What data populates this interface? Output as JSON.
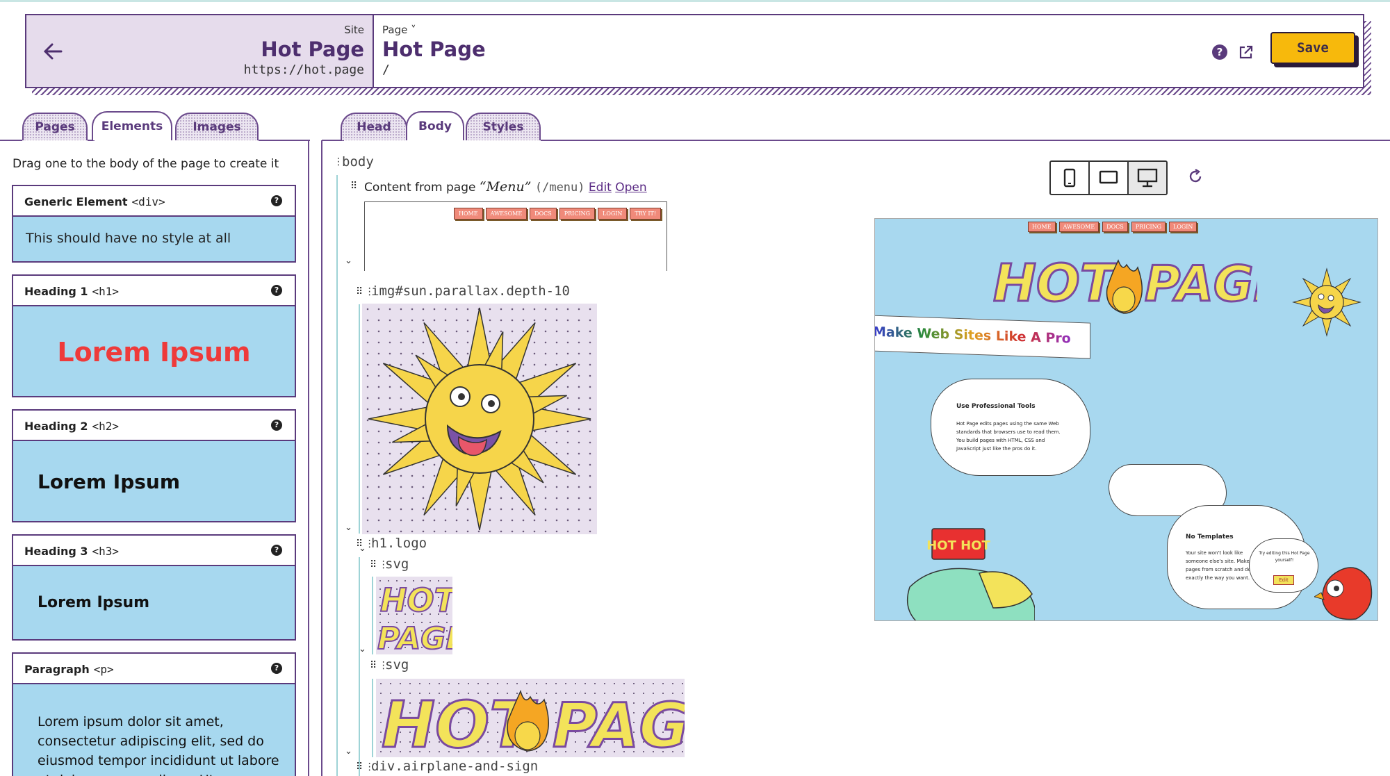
{
  "header": {
    "site_label": "Site",
    "site_title": "Hot Page",
    "site_url": "https://hot.page",
    "page_label": "Page ˅",
    "page_title": "Hot Page",
    "page_path": "/",
    "help_glyph": "?",
    "save_label": "Save"
  },
  "left_tabs": [
    {
      "label": "Pages",
      "active": false
    },
    {
      "label": "Elements",
      "active": true
    },
    {
      "label": "Images",
      "active": false
    }
  ],
  "mid_tabs": [
    {
      "label": "Head",
      "active": false
    },
    {
      "label": "Body",
      "active": true
    },
    {
      "label": "Styles",
      "active": false
    }
  ],
  "elements_panel": {
    "hint": "Drag one to the body of the page to create it",
    "cards": [
      {
        "name": "Generic Element",
        "tag": "<div>",
        "preview": "This should have no style at all"
      },
      {
        "name": "Heading 1",
        "tag": "<h1>",
        "preview": "Lorem Ipsum"
      },
      {
        "name": "Heading 2",
        "tag": "<h2>",
        "preview": "Lorem Ipsum"
      },
      {
        "name": "Heading 3",
        "tag": "<h3>",
        "preview": "Lorem Ipsum"
      },
      {
        "name": "Paragraph",
        "tag": "<p>",
        "preview": "Lorem ipsum dolor sit amet, consectetur adipiscing elit, sed do eiusmod tempor incididunt ut labore et dolore magna aliqua. Ut"
      }
    ]
  },
  "tree": {
    "root": "body",
    "content_from": "Content from page",
    "content_page": "“Menu”",
    "content_path": "(/menu)",
    "edit_link": "Edit",
    "open_link": "Open",
    "nodes": [
      "img#sun.parallax.depth-10",
      "h1.logo",
      "svg",
      "svg",
      "div.airplane-and-sign"
    ]
  },
  "menu_items": [
    "HOME",
    "AWESOME",
    "DOCS",
    "PRICING",
    "LOGIN",
    "TRY IT!"
  ],
  "preview": {
    "menu_items": [
      "HOME",
      "AWESOME",
      "DOCS",
      "PRICING",
      "LOGIN"
    ],
    "logo_text_left": "HOT",
    "logo_text_right": "PAGE",
    "banner": "Make Web Sites Like A Pro",
    "cloud1_title": "Use Professional Tools",
    "cloud1_body": "Hot Page edits pages using the same Web standards that browsers use to read them. You build pages with HTML, CSS and JavaScript just like the pros do it.",
    "cloud2_title": "No Templates",
    "cloud2_body": "Your site won't look like someone else's site. Make your pages from scratch and do exactly the way you want.",
    "bubble_text": "Try editing this Hot Page yourself!",
    "bubble_button": "Edit",
    "sign_text": "HOT HOT"
  },
  "colors": {
    "accent": "#5a3a7c",
    "save": "#f7b90c",
    "card_blue": "#a7d8ef",
    "h1_red": "#ee3a3a",
    "header_bg": "#e6dcec"
  }
}
